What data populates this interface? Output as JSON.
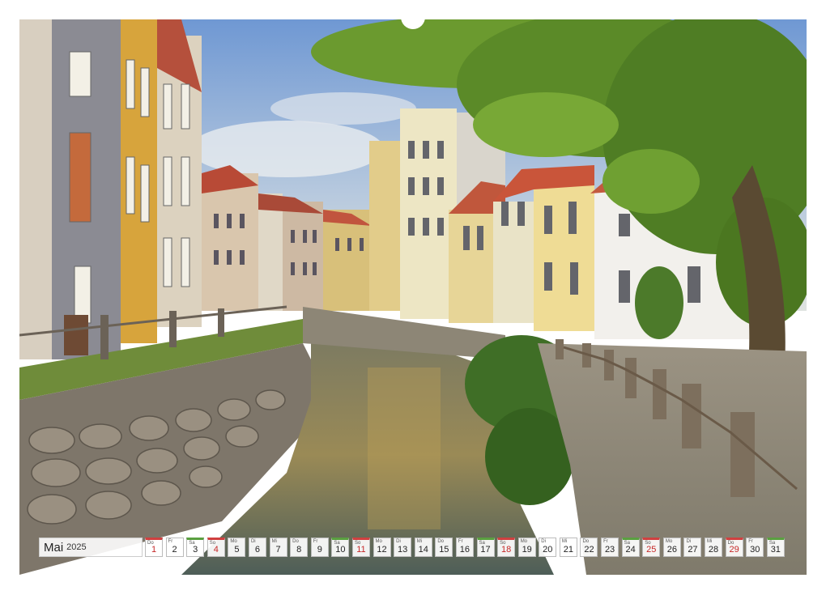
{
  "calendar": {
    "month": "Mai",
    "year": "2025",
    "days": [
      {
        "num": "1",
        "dn": "Do",
        "type": "holiday"
      },
      {
        "num": "2",
        "dn": "Fr",
        "type": ""
      },
      {
        "num": "3",
        "dn": "Sa",
        "type": "sat"
      },
      {
        "num": "4",
        "dn": "So",
        "type": "sun"
      },
      {
        "num": "5",
        "dn": "Mo",
        "type": ""
      },
      {
        "num": "6",
        "dn": "Di",
        "type": ""
      },
      {
        "num": "7",
        "dn": "Mi",
        "type": ""
      },
      {
        "num": "8",
        "dn": "Do",
        "type": ""
      },
      {
        "num": "9",
        "dn": "Fr",
        "type": ""
      },
      {
        "num": "10",
        "dn": "Sa",
        "type": "sat"
      },
      {
        "num": "11",
        "dn": "So",
        "type": "sun"
      },
      {
        "num": "12",
        "dn": "Mo",
        "type": ""
      },
      {
        "num": "13",
        "dn": "Di",
        "type": ""
      },
      {
        "num": "14",
        "dn": "Mi",
        "type": ""
      },
      {
        "num": "15",
        "dn": "Do",
        "type": ""
      },
      {
        "num": "16",
        "dn": "Fr",
        "type": ""
      },
      {
        "num": "17",
        "dn": "Sa",
        "type": "sat"
      },
      {
        "num": "18",
        "dn": "So",
        "type": "sun"
      },
      {
        "num": "19",
        "dn": "Mo",
        "type": ""
      },
      {
        "num": "20",
        "dn": "Di",
        "type": ""
      },
      {
        "num": "21",
        "dn": "Mi",
        "type": ""
      },
      {
        "num": "22",
        "dn": "Do",
        "type": ""
      },
      {
        "num": "23",
        "dn": "Fr",
        "type": ""
      },
      {
        "num": "24",
        "dn": "Sa",
        "type": "sat"
      },
      {
        "num": "25",
        "dn": "So",
        "type": "sun"
      },
      {
        "num": "26",
        "dn": "Mo",
        "type": ""
      },
      {
        "num": "27",
        "dn": "Di",
        "type": ""
      },
      {
        "num": "28",
        "dn": "Mi",
        "type": ""
      },
      {
        "num": "29",
        "dn": "Do",
        "type": "holiday"
      },
      {
        "num": "30",
        "dn": "Fr",
        "type": ""
      },
      {
        "num": "31",
        "dn": "Sa",
        "type": "sat"
      }
    ]
  },
  "colors": {
    "sky": "#7ea6d8",
    "water": "#6d7a6a",
    "foliage": "#5f8a2c",
    "sunday": "#c62828",
    "saturday": "#5aa040"
  }
}
